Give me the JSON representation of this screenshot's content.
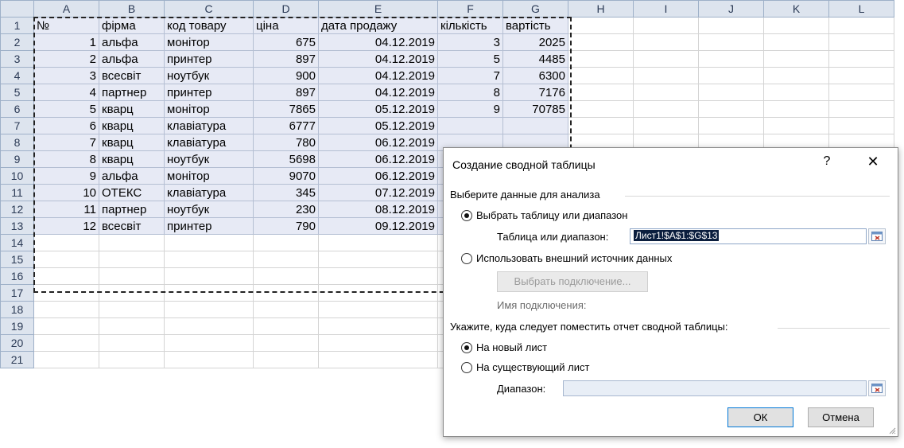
{
  "sheet": {
    "columns": [
      "A",
      "B",
      "C",
      "D",
      "E",
      "F",
      "G",
      "H",
      "I",
      "J",
      "K",
      "L"
    ],
    "row_numbers": [
      "1",
      "2",
      "3",
      "4",
      "5",
      "6",
      "7",
      "8",
      "9",
      "10",
      "11",
      "12",
      "13",
      "14",
      "15",
      "16",
      "17",
      "18",
      "19",
      "20",
      "21"
    ],
    "headers": [
      "№",
      "фірма",
      "код товару",
      "ціна",
      "дата продажу",
      "кількість",
      "вартість"
    ],
    "rows": [
      [
        "1",
        "альфа",
        "монітор",
        "675",
        "04.12.2019",
        "3",
        "2025"
      ],
      [
        "2",
        "альфа",
        "принтер",
        "897",
        "04.12.2019",
        "5",
        "4485"
      ],
      [
        "3",
        "всесвіт",
        "ноутбук",
        "900",
        "04.12.2019",
        "7",
        "6300"
      ],
      [
        "4",
        "партнер",
        "принтер",
        "897",
        "04.12.2019",
        "8",
        "7176"
      ],
      [
        "5",
        "кварц",
        "монітор",
        "7865",
        "05.12.2019",
        "9",
        "70785"
      ],
      [
        "6",
        "кварц",
        "клавіатура",
        "6777",
        "05.12.2019",
        "",
        ""
      ],
      [
        "7",
        "кварц",
        "клавіатура",
        "780",
        "06.12.2019",
        "",
        ""
      ],
      [
        "8",
        "кварц",
        "ноутбук",
        "5698",
        "06.12.2019",
        "",
        ""
      ],
      [
        "9",
        "альфа",
        "монітор",
        "9070",
        "06.12.2019",
        "",
        ""
      ],
      [
        "10",
        "ОТЕКС",
        "клавіатура",
        "345",
        "07.12.2019",
        "",
        ""
      ],
      [
        "11",
        "партнер",
        "ноутбук",
        "230",
        "08.12.2019",
        "",
        ""
      ],
      [
        "12",
        "всесвіт",
        "принтер",
        "790",
        "09.12.2019",
        "",
        ""
      ]
    ]
  },
  "dialog": {
    "title": "Создание сводной таблицы",
    "help": "?",
    "close": "✕",
    "section1": "Выберите данные для анализа",
    "radio_table": "Выбрать таблицу или диапазон",
    "table_range_label": "Таблица или диапазон:",
    "table_range_value": "Лист1!$A$1:$G$13",
    "radio_external": "Использовать внешний источник данных",
    "choose_connection": "Выбрать подключение...",
    "connection_name_label": "Имя подключения:",
    "section2": "Укажите, куда следует поместить отчет сводной таблицы:",
    "radio_new_sheet": "На новый лист",
    "radio_existing": "На существующий лист",
    "range_label": "Диапазон:",
    "ok": "ОК",
    "cancel": "Отмена"
  },
  "colors": {
    "header_bg": "#dde4ee",
    "selection_bg": "#e7eaf5",
    "accent": "#0078d7"
  }
}
